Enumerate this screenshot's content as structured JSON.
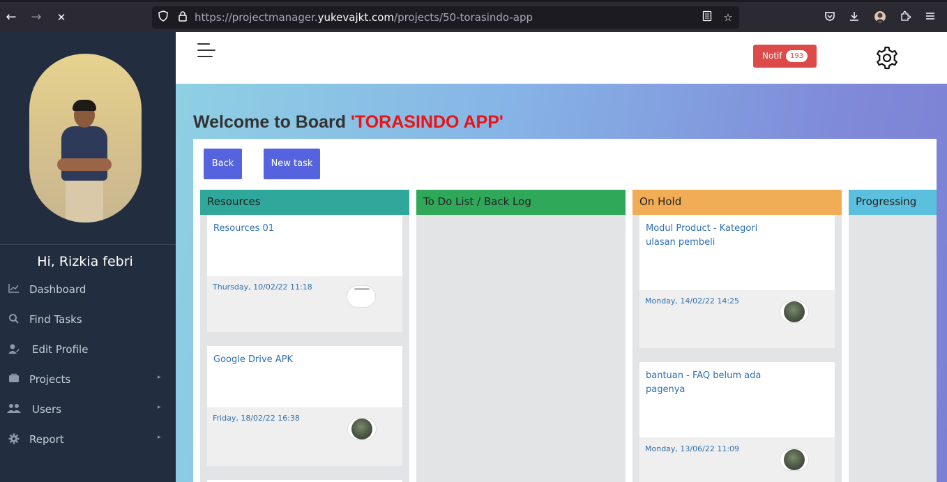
{
  "browser": {
    "url_prefix": "https://projectmanager.",
    "url_domain": "yukevajkt.com",
    "url_path": "/projects/50-torasindo-app",
    "back_icon": "←",
    "forward_icon": "→",
    "stop_icon": "✕"
  },
  "sidebar": {
    "greeting": "Hi, Rizkia febri",
    "items": [
      {
        "label": "Dashboard",
        "icon": "chart-line-icon",
        "glyph": "📈",
        "has_caret": false
      },
      {
        "label": "Find Tasks",
        "icon": "search-icon",
        "glyph": "⚲",
        "has_caret": false
      },
      {
        "label": "Edit Profile",
        "icon": "user-edit-icon",
        "glyph": "👤",
        "has_caret": false
      },
      {
        "label": "Projects",
        "icon": "briefcase-icon",
        "glyph": "💼",
        "has_caret": true
      },
      {
        "label": "Users",
        "icon": "users-icon",
        "glyph": "👥",
        "has_caret": true
      },
      {
        "label": "Report",
        "icon": "gear-icon",
        "glyph": "⚙",
        "has_caret": true
      }
    ],
    "caret": "▸"
  },
  "header": {
    "notif_label": "Notif",
    "notif_count": "193"
  },
  "main": {
    "title_prefix": "Welcome to Board ",
    "project_name": "'TORASINDO APP'",
    "back_label": "Back",
    "new_task_label": "New task"
  },
  "colors": {
    "resources": "#2fa79a",
    "todo": "#2fa85a",
    "on_hold": "#f0ad55",
    "progressing": "#5bc0de",
    "button": "#5563de",
    "notif": "#dc4a4a"
  },
  "columns": [
    {
      "name": "Resources",
      "cards": [
        {
          "title": "Resources 01",
          "date": "Thursday, 10/02/22 11:18",
          "avatar": "empty"
        },
        {
          "title": "Google Drive APK",
          "date": "Friday, 18/02/22 16:38",
          "avatar": "photo"
        }
      ]
    },
    {
      "name": "To Do List / Back Log",
      "cards": []
    },
    {
      "name": "On Hold",
      "cards": [
        {
          "title": "Modul Product - Kategori ulasan pembeli",
          "date": "Monday, 14/02/22 14:25",
          "avatar": "photo"
        },
        {
          "title": "bantuan - FAQ belum ada pagenya",
          "date": "Monday, 13/06/22 11:09",
          "avatar": "photo"
        }
      ]
    },
    {
      "name": "Progressing",
      "cards": []
    }
  ]
}
